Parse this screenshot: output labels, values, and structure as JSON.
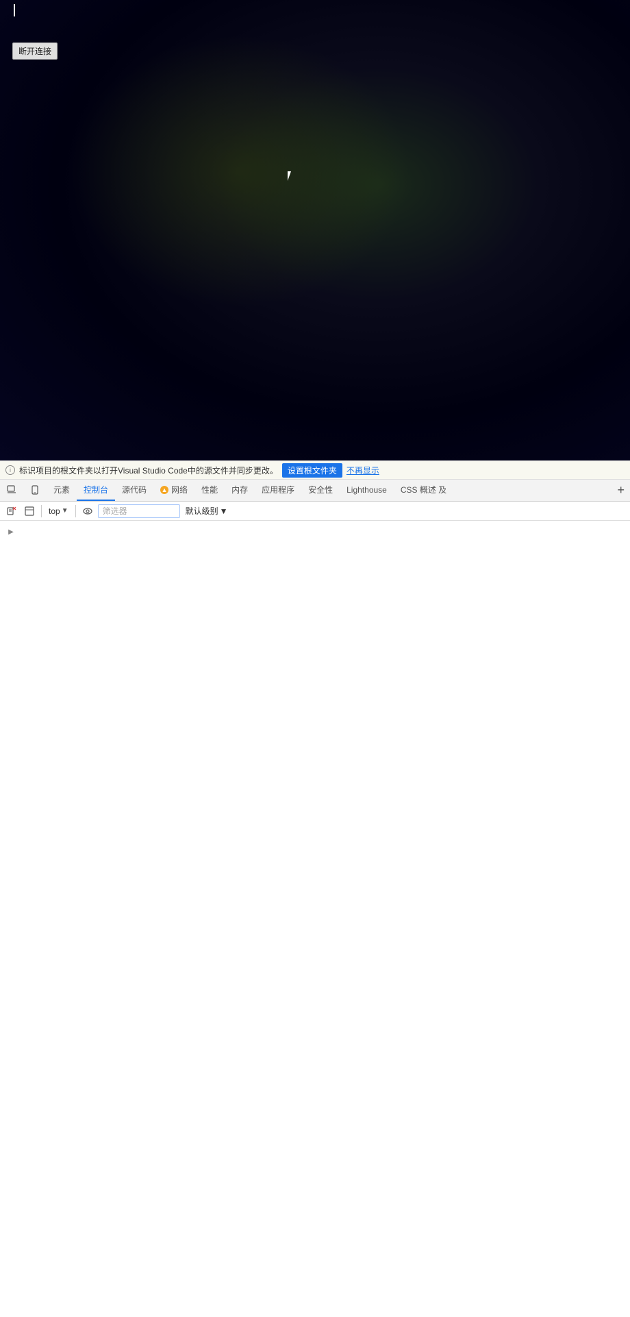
{
  "viewport": {
    "bg_description": "dark screen with cursor"
  },
  "disconnect_button": {
    "label": "断开连接"
  },
  "info_bar": {
    "icon_label": "i",
    "text": "标识项目的根文件夹以打开Visual Studio Code中的源文件并同步更改。",
    "setup_btn": "设置根文件夹",
    "dismiss_btn": "不再显示"
  },
  "devtools_tabs": [
    {
      "id": "inspect",
      "label": "",
      "icon": "inspect-icon",
      "active": false
    },
    {
      "id": "device",
      "label": "",
      "icon": "device-icon",
      "active": false
    },
    {
      "id": "elements",
      "label": "元素",
      "active": false
    },
    {
      "id": "console",
      "label": "控制台",
      "active": true
    },
    {
      "id": "sources",
      "label": "源代码",
      "active": false
    },
    {
      "id": "network",
      "label": "网络",
      "warning": true,
      "active": false
    },
    {
      "id": "performance",
      "label": "性能",
      "active": false
    },
    {
      "id": "memory",
      "label": "内存",
      "active": false
    },
    {
      "id": "application",
      "label": "应用程序",
      "active": false
    },
    {
      "id": "security",
      "label": "安全性",
      "active": false
    },
    {
      "id": "lighthouse",
      "label": "Lighthouse",
      "active": false
    },
    {
      "id": "css-overview",
      "label": "CSS 概述 及",
      "active": false
    }
  ],
  "console_toolbar": {
    "clear_btn": "clear-console",
    "expand_btn": "expand",
    "context_label": "top",
    "eye_label": "eye",
    "filter_placeholder": "筛选器",
    "level_label": "默认级别",
    "chevron": "▼"
  },
  "console_rows": [
    {
      "id": "row1",
      "expand": true
    }
  ]
}
